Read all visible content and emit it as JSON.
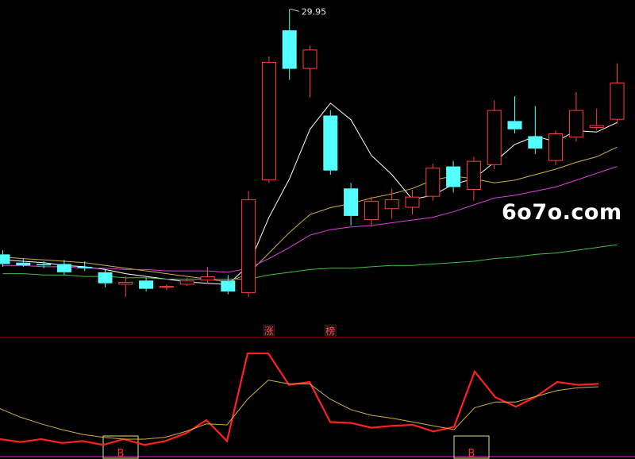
{
  "watermark": "6o7o.com",
  "chart_data": [
    {
      "type": "candlestick",
      "title": "",
      "price_scale": {
        "min": 7.5,
        "max": 30.2
      },
      "peak_label": "29.95",
      "up_color": "#ff4040",
      "down_color": "#54ffff",
      "candles": [
        {
          "o": 12.1,
          "h": 12.4,
          "l": 11.2,
          "c": 11.4
        },
        {
          "o": 11.5,
          "h": 11.8,
          "l": 11.2,
          "c": 11.3
        },
        {
          "o": 11.4,
          "h": 11.6,
          "l": 11.1,
          "c": 11.3
        },
        {
          "o": 11.4,
          "h": 11.7,
          "l": 10.6,
          "c": 10.8
        },
        {
          "o": 11.2,
          "h": 11.6,
          "l": 10.9,
          "c": 11.1
        },
        {
          "o": 10.8,
          "h": 11.0,
          "l": 9.7,
          "c": 10.0
        },
        {
          "o": 9.9,
          "h": 10.5,
          "l": 9.0,
          "c": 10.1
        },
        {
          "o": 10.2,
          "h": 10.4,
          "l": 9.4,
          "c": 9.6
        },
        {
          "o": 9.7,
          "h": 9.9,
          "l": 9.5,
          "c": 9.8
        },
        {
          "o": 9.9,
          "h": 10.4,
          "l": 9.8,
          "c": 10.2
        },
        {
          "o": 10.2,
          "h": 11.2,
          "l": 10.0,
          "c": 10.5
        },
        {
          "o": 10.2,
          "h": 10.6,
          "l": 9.2,
          "c": 9.4
        },
        {
          "o": 9.3,
          "h": 16.7,
          "l": 9.0,
          "c": 16.1
        },
        {
          "o": 17.5,
          "h": 26.5,
          "l": 17.3,
          "c": 26.1
        },
        {
          "o": 28.4,
          "h": 29.95,
          "l": 24.8,
          "c": 25.6
        },
        {
          "o": 25.6,
          "h": 27.3,
          "l": 23.5,
          "c": 27.0
        },
        {
          "o": 22.2,
          "h": 22.6,
          "l": 17.9,
          "c": 18.2
        },
        {
          "o": 16.9,
          "h": 17.3,
          "l": 14.2,
          "c": 14.9
        },
        {
          "o": 14.6,
          "h": 16.3,
          "l": 14.1,
          "c": 16.0
        },
        {
          "o": 15.4,
          "h": 16.9,
          "l": 14.7,
          "c": 16.1
        },
        {
          "o": 15.5,
          "h": 16.8,
          "l": 15.0,
          "c": 16.3
        },
        {
          "o": 16.3,
          "h": 18.7,
          "l": 16.0,
          "c": 18.4
        },
        {
          "o": 18.5,
          "h": 18.9,
          "l": 16.6,
          "c": 17.0
        },
        {
          "o": 16.8,
          "h": 19.2,
          "l": 16.0,
          "c": 18.9
        },
        {
          "o": 18.6,
          "h": 23.3,
          "l": 18.3,
          "c": 22.6
        },
        {
          "o": 21.8,
          "h": 23.6,
          "l": 20.9,
          "c": 21.2
        },
        {
          "o": 20.7,
          "h": 22.9,
          "l": 19.4,
          "c": 19.8
        },
        {
          "o": 18.9,
          "h": 21.1,
          "l": 18.6,
          "c": 20.9
        },
        {
          "o": 20.6,
          "h": 23.9,
          "l": 20.3,
          "c": 22.6
        },
        {
          "o": 21.3,
          "h": 22.7,
          "l": 21.1,
          "c": 21.5
        },
        {
          "o": 21.9,
          "h": 26.0,
          "l": 21.6,
          "c": 24.6
        }
      ],
      "ma_lines": [
        {
          "color": "#ffffff",
          "values": [
            11.7,
            11.6,
            11.5,
            11.3,
            11.2,
            11.0,
            10.7,
            10.5,
            10.3,
            10.1,
            10.0,
            9.9,
            11.3,
            14.8,
            17.6,
            21.2,
            23.1,
            21.9,
            19.3,
            17.9,
            16.1,
            16.4,
            17.2,
            17.6,
            18.8,
            20.1,
            20.7,
            20.3,
            21.1,
            21.0,
            21.7
          ]
        },
        {
          "color": "#d0b040",
          "values": [
            11.9,
            11.8,
            11.7,
            11.6,
            11.5,
            11.3,
            11.1,
            10.9,
            10.7,
            10.5,
            10.3,
            10.1,
            10.7,
            12.2,
            13.7,
            15.0,
            15.5,
            15.8,
            16.2,
            16.5,
            16.9,
            17.5,
            17.8,
            17.6,
            17.3,
            17.5,
            17.9,
            18.3,
            18.8,
            19.2,
            19.9
          ]
        },
        {
          "color": "#e040e0",
          "values": [
            11.3,
            11.3,
            11.2,
            11.2,
            11.1,
            11.1,
            11.0,
            11.0,
            10.9,
            10.9,
            10.9,
            10.8,
            11.1,
            11.8,
            12.6,
            13.5,
            13.9,
            14.1,
            14.2,
            14.4,
            14.6,
            14.8,
            15.2,
            15.7,
            16.2,
            16.4,
            16.7,
            17.0,
            17.5,
            18.0,
            18.5
          ]
        },
        {
          "color": "#40c040",
          "values": [
            10.7,
            10.7,
            10.6,
            10.6,
            10.5,
            10.5,
            10.4,
            10.4,
            10.3,
            10.3,
            10.3,
            10.3,
            10.3,
            10.6,
            10.8,
            11.0,
            11.1,
            11.1,
            11.2,
            11.3,
            11.3,
            11.4,
            11.5,
            11.6,
            11.8,
            11.9,
            12.1,
            12.2,
            12.4,
            12.6,
            12.8
          ]
        }
      ],
      "annotations": [
        {
          "text": "涨",
          "index": 13
        },
        {
          "text": "榜",
          "index": 16
        }
      ]
    },
    {
      "type": "line",
      "title": "",
      "y_scale": {
        "min": 0,
        "max": 100
      },
      "series": [
        {
          "color": "#ff2020",
          "values": [
            10,
            7,
            10,
            6,
            8,
            4,
            10,
            4,
            8,
            16,
            30,
            8,
            100,
            100,
            67,
            70,
            28,
            27,
            22,
            24,
            25,
            18,
            23,
            81,
            54,
            44,
            55,
            70,
            67,
            68
          ]
        },
        {
          "color": "#d0b040",
          "values": [
            42,
            33,
            26,
            20,
            15,
            12,
            10,
            10,
            12,
            18,
            26,
            25,
            52,
            72,
            68,
            68,
            52,
            41,
            35,
            32,
            28,
            24,
            20,
            43,
            49,
            49,
            55,
            61,
            64,
            65
          ]
        }
      ],
      "signals": [
        {
          "text": "B",
          "index": 5
        },
        {
          "text": "B",
          "index": 22
        }
      ]
    }
  ]
}
